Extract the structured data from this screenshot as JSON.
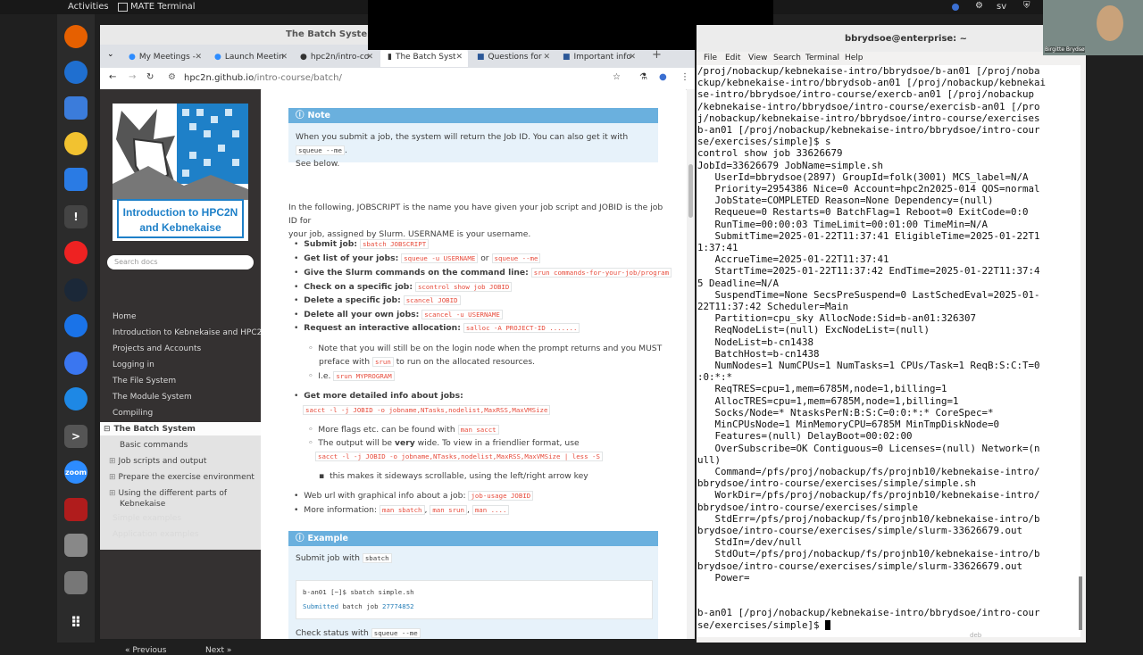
{
  "topbar": {
    "activities": "Activities",
    "terminal_app": "MATE Terminal",
    "user": "sv"
  },
  "dock": {
    "icons": [
      "firefox-icon",
      "thunderbird-icon",
      "files-icon",
      "rhythmbox-icon",
      "writer-icon",
      "terminal-icon",
      "help-icon",
      "steam-icon",
      "chrome-icon",
      "signal-icon",
      "network-icon",
      "next-icon",
      "zoom-icon",
      "filezilla-icon",
      "disk-icon",
      "trash-icon",
      "apps-grid-icon"
    ],
    "zoom_label": "zoom"
  },
  "browser": {
    "window_title": "The Batch System - In",
    "tabs": [
      {
        "label": "My Meetings -"
      },
      {
        "label": "Launch Meetin"
      },
      {
        "label": "hpc2n/intro-co"
      },
      {
        "label": "The Batch Syst"
      },
      {
        "label": "Questions for"
      },
      {
        "label": "Important info"
      }
    ],
    "url_host": "hpc2n.github.io",
    "url_path": "/intro-course/batch/"
  },
  "sidenav": {
    "logo_text_1": "Introduction to HPC2N",
    "logo_text_2": "and Kebnekaise",
    "search_placeholder": "Search docs",
    "items": [
      "Home",
      "Introduction to Kebnekaise and HPC2N",
      "Projects and Accounts",
      "Logging in",
      "The File System",
      "The Module System",
      "Compiling"
    ],
    "current": "The Batch System",
    "subitems": [
      "Basic commands",
      "Job scripts and output",
      "Prepare the exercise environment",
      "Using the different parts of",
      "Kebnekaise"
    ],
    "after": [
      "Simple examples",
      "Application examples"
    ],
    "prev": "« Previous",
    "next": "Next »"
  },
  "content": {
    "note_title": "Note",
    "note_line1": "When you submit a job, the system will return the Job ID. You can also get it with",
    "note_code": "squeue --me",
    "note_line2": "See below.",
    "intro1": "In the following, JOBSCRIPT is the name you have given your job script and JOBID is the job ID for",
    "intro2": "your job, assigned by Slurm. USERNAME is your username.",
    "b1_label": "Submit job:",
    "b1_code": "sbatch JOBSCRIPT",
    "b2_label": "Get list of your jobs:",
    "b2_code": "squeue -u USERNAME",
    "b2_or": "or",
    "b2_code2": "squeue --me",
    "b3_label": "Give the Slurm commands on the command line:",
    "b3_code": "srun commands-for-your-job/program",
    "b4_label": "Check on a specific job:",
    "b4_code": "scontrol show job JOBID",
    "b5_label": "Delete a specific job:",
    "b5_code": "scancel JOBID",
    "b6_label": "Delete all your own jobs:",
    "b6_code": "scancel -u USERNAME",
    "b7_label": "Request an interactive allocation:",
    "b7_code": "salloc -A PROJECT-ID .......",
    "s1_line1": "Note that you will still be on the login node when the prompt returns and you MUST",
    "s1_line2a": "preface with",
    "s1_code": "srun",
    "s1_line2b": "to run on the allocated resources.",
    "s2_a": "I.e.",
    "s2_code": "srun MYPROGRAM",
    "b8_label": "Get more detailed info about jobs:",
    "b8_code": "sacct -l -j JOBID -o jobname,NTasks,nodelist,MaxRSS,MaxVMSize",
    "s3_a": "More flags etc. can be found with",
    "s3_code": "man sacct",
    "s4_a": "The output will be",
    "s4_b": "very",
    "s4_c": "wide. To view in a friendlier format, use",
    "s4_code": "sacct -l -j JOBID -o jobname,NTasks,nodelist,MaxRSS,MaxVMSize | less -S",
    "s5": "this makes it sideways scrollable, using the left/right arrow key",
    "b9_a": "Web url with graphical info about a job:",
    "b9_code": "job-usage JOBID",
    "b10_a": "More information:",
    "b10_c1": "man sbatch",
    "b10_c2": "man srun",
    "b10_c3": "man ....",
    "ex_title": "Example",
    "ex_submit": "Submit job with",
    "ex_submit_code": "sbatch",
    "ex_cmd": "b-an01 [~]$ sbatch simple.sh",
    "ex_out_a": "Submitted",
    "ex_out_b": "batch job",
    "ex_out_c": "27774852",
    "ex_check": "Check status with",
    "ex_check_code": "squeue --me"
  },
  "terminal": {
    "title": "bbrydsoe@enterprise: ~",
    "menu": [
      "File",
      "Edit",
      "View",
      "Search",
      "Terminal",
      "Help"
    ],
    "lines": [
      "/proj/nobackup/kebnekaise-intro/bbrydsoe/b-an01 [/proj/noba",
      "ckup/kebnekaise-intro/bbrydsob-an01 [/proj/nobackup/kebnekai",
      "se-intro/bbrydsoe/intro-course/exercb-an01 [/proj/nobackup",
      "/kebnekaise-intro/bbrydsoe/intro-course/exercisb-an01 [/pro",
      "j/nobackup/kebnekaise-intro/bbrydsoe/intro-course/exercises",
      "b-an01 [/proj/nobackup/kebnekaise-intro/bbrydsoe/intro-cour",
      "se/exercises/simple]$ s",
      "control show job 33626679",
      "JobId=33626679 JobName=simple.sh",
      "   UserId=bbrydsoe(2897) GroupId=folk(3001) MCS_label=N/A",
      "   Priority=2954386 Nice=0 Account=hpc2n2025-014 QOS=normal",
      "   JobState=COMPLETED Reason=None Dependency=(null)",
      "   Requeue=0 Restarts=0 BatchFlag=1 Reboot=0 ExitCode=0:0",
      "   RunTime=00:00:03 TimeLimit=00:01:00 TimeMin=N/A",
      "   SubmitTime=2025-01-22T11:37:41 EligibleTime=2025-01-22T1",
      "1:37:41",
      "   AccrueTime=2025-01-22T11:37:41",
      "   StartTime=2025-01-22T11:37:42 EndTime=2025-01-22T11:37:4",
      "5 Deadline=N/A",
      "   SuspendTime=None SecsPreSuspend=0 LastSchedEval=2025-01-",
      "22T11:37:42 Scheduler=Main",
      "   Partition=cpu_sky AllocNode:Sid=b-an01:326307",
      "   ReqNodeList=(null) ExcNodeList=(null)",
      "   NodeList=b-cn1438",
      "   BatchHost=b-cn1438",
      "   NumNodes=1 NumCPUs=1 NumTasks=1 CPUs/Task=1 ReqB:S:C:T=0",
      ":0:*:*",
      "   ReqTRES=cpu=1,mem=6785M,node=1,billing=1",
      "   AllocTRES=cpu=1,mem=6785M,node=1,billing=1",
      "   Socks/Node=* NtasksPerN:B:S:C=0:0:*:* CoreSpec=*",
      "   MinCPUsNode=1 MinMemoryCPU=6785M MinTmpDiskNode=0",
      "   Features=(null) DelayBoot=00:02:00",
      "   OverSubscribe=OK Contiguous=0 Licenses=(null) Network=(n",
      "ull)",
      "   Command=/pfs/proj/nobackup/fs/projnb10/kebnekaise-intro/",
      "bbrydsoe/intro-course/exercises/simple/simple.sh",
      "   WorkDir=/pfs/proj/nobackup/fs/projnb10/kebnekaise-intro/",
      "bbrydsoe/intro-course/exercises/simple",
      "   StdErr=/pfs/proj/nobackup/fs/projnb10/kebnekaise-intro/b",
      "brydsoe/intro-course/exercises/simple/slurm-33626679.out",
      "   StdIn=/dev/null",
      "   StdOut=/pfs/proj/nobackup/fs/projnb10/kebnekaise-intro/b",
      "brydsoe/intro-course/exercises/simple/slurm-33626679.out",
      "   Power=",
      "",
      "",
      "b-an01 [/proj/nobackup/kebnekaise-intro/bbrydsoe/intro-cour",
      "se/exercises/simple]$ "
    ]
  },
  "webcam": {
    "name": "Birgitte Brydsø"
  },
  "bottom_text": "deb"
}
